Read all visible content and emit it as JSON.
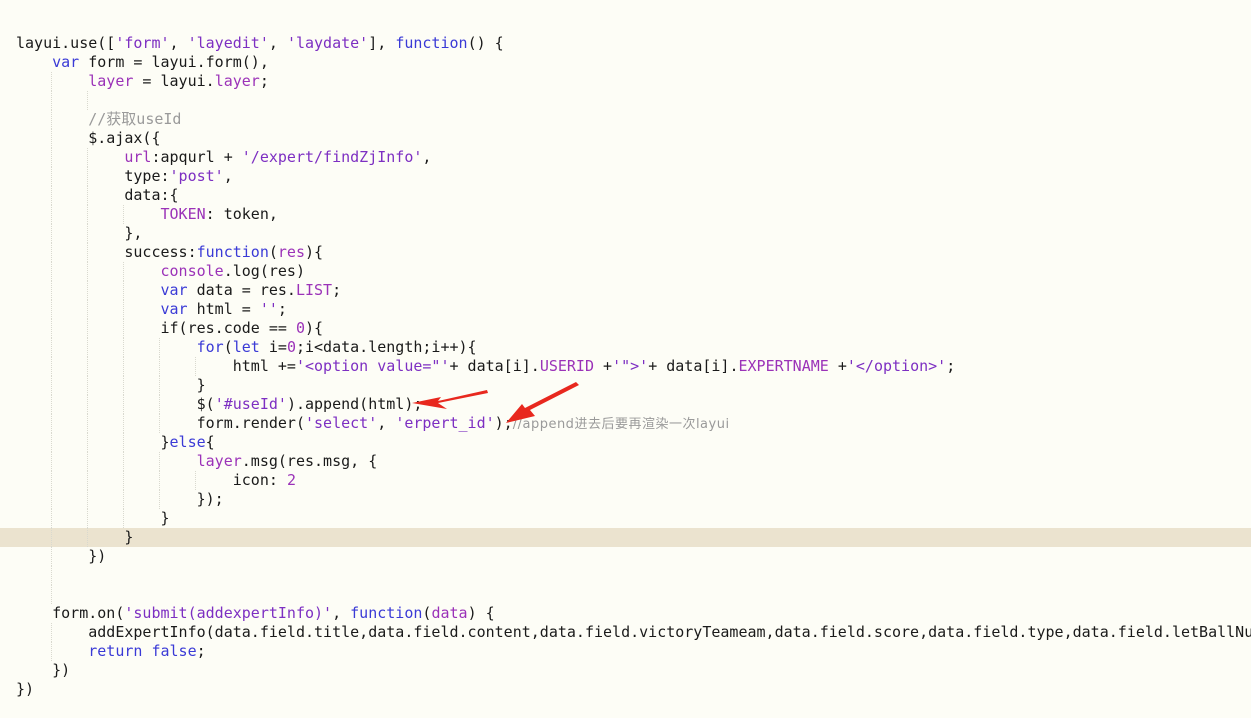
{
  "editor": {
    "lines": [
      {
        "indent": 0,
        "guides": [],
        "tokens": [
          {
            "t": "pl",
            "v": "layui.use(["
          },
          {
            "t": "str",
            "v": "'form'"
          },
          {
            "t": "pl",
            "v": ", "
          },
          {
            "t": "str",
            "v": "'layedit'"
          },
          {
            "t": "pl",
            "v": ", "
          },
          {
            "t": "str",
            "v": "'laydate'"
          },
          {
            "t": "pl",
            "v": "], "
          },
          {
            "t": "kw",
            "v": "function"
          },
          {
            "t": "pl",
            "v": "() {"
          }
        ]
      },
      {
        "indent": 1,
        "guides": [],
        "tokens": [
          {
            "t": "kw",
            "v": "var"
          },
          {
            "t": "pl",
            "v": " form = layui.form(),"
          }
        ]
      },
      {
        "indent": 2,
        "guides": [
          1
        ],
        "tokens": [
          {
            "t": "prop",
            "v": "layer"
          },
          {
            "t": "pl",
            "v": " = layui."
          },
          {
            "t": "prop",
            "v": "layer"
          },
          {
            "t": "pl",
            "v": ";"
          }
        ]
      },
      {
        "indent": 0,
        "guides": [
          1,
          2
        ],
        "tokens": []
      },
      {
        "indent": 2,
        "guides": [
          1
        ],
        "tokens": [
          {
            "t": "cmt",
            "v": "//获取useId"
          }
        ]
      },
      {
        "indent": 2,
        "guides": [
          1
        ],
        "tokens": [
          {
            "t": "pl",
            "v": "$.ajax({"
          }
        ]
      },
      {
        "indent": 3,
        "guides": [
          1,
          2
        ],
        "tokens": [
          {
            "t": "prop",
            "v": "url"
          },
          {
            "t": "pl",
            "v": ":apqurl + "
          },
          {
            "t": "str",
            "v": "'/expert/findZjInfo'"
          },
          {
            "t": "pl",
            "v": ","
          }
        ]
      },
      {
        "indent": 3,
        "guides": [
          1,
          2
        ],
        "tokens": [
          {
            "t": "pl",
            "v": "type:"
          },
          {
            "t": "str",
            "v": "'post'"
          },
          {
            "t": "pl",
            "v": ","
          }
        ]
      },
      {
        "indent": 3,
        "guides": [
          1,
          2
        ],
        "tokens": [
          {
            "t": "pl",
            "v": "data:{"
          }
        ]
      },
      {
        "indent": 4,
        "guides": [
          1,
          2,
          3
        ],
        "tokens": [
          {
            "t": "prop",
            "v": "TOKEN"
          },
          {
            "t": "pl",
            "v": ": token,"
          }
        ]
      },
      {
        "indent": 3,
        "guides": [
          1,
          2
        ],
        "tokens": [
          {
            "t": "pl",
            "v": "},"
          }
        ]
      },
      {
        "indent": 3,
        "guides": [
          1,
          2
        ],
        "tokens": [
          {
            "t": "pl",
            "v": "success:"
          },
          {
            "t": "kw",
            "v": "function"
          },
          {
            "t": "pl",
            "v": "("
          },
          {
            "t": "prop",
            "v": "res"
          },
          {
            "t": "pl",
            "v": "){"
          }
        ]
      },
      {
        "indent": 4,
        "guides": [
          1,
          2,
          3
        ],
        "tokens": [
          {
            "t": "prop",
            "v": "console"
          },
          {
            "t": "pl",
            "v": ".log(res)"
          }
        ]
      },
      {
        "indent": 4,
        "guides": [
          1,
          2,
          3
        ],
        "tokens": [
          {
            "t": "kw",
            "v": "var"
          },
          {
            "t": "pl",
            "v": " data = res."
          },
          {
            "t": "prop",
            "v": "LIST"
          },
          {
            "t": "pl",
            "v": ";"
          }
        ]
      },
      {
        "indent": 4,
        "guides": [
          1,
          2,
          3
        ],
        "tokens": [
          {
            "t": "kw",
            "v": "var"
          },
          {
            "t": "pl",
            "v": " html = "
          },
          {
            "t": "str",
            "v": "''"
          },
          {
            "t": "pl",
            "v": ";"
          }
        ]
      },
      {
        "indent": 4,
        "guides": [
          1,
          2,
          3
        ],
        "tokens": [
          {
            "t": "pl",
            "v": "if(res.code == "
          },
          {
            "t": "num",
            "v": "0"
          },
          {
            "t": "pl",
            "v": "){"
          }
        ]
      },
      {
        "indent": 5,
        "guides": [
          1,
          2,
          3,
          4
        ],
        "tokens": [
          {
            "t": "kw",
            "v": "for"
          },
          {
            "t": "pl",
            "v": "("
          },
          {
            "t": "kw",
            "v": "let"
          },
          {
            "t": "pl",
            "v": " i="
          },
          {
            "t": "num",
            "v": "0"
          },
          {
            "t": "pl",
            "v": ";i<data.length;i++){"
          }
        ]
      },
      {
        "indent": 6,
        "guides": [
          1,
          2,
          3,
          4,
          5
        ],
        "tokens": [
          {
            "t": "pl",
            "v": "html +="
          },
          {
            "t": "str",
            "v": "'<option value=\"'"
          },
          {
            "t": "pl",
            "v": "+ data[i]."
          },
          {
            "t": "prop",
            "v": "USERID"
          },
          {
            "t": "pl",
            "v": " +"
          },
          {
            "t": "str",
            "v": "'\">'"
          },
          {
            "t": "pl",
            "v": "+ data[i]."
          },
          {
            "t": "prop",
            "v": "EXPERTNAME"
          },
          {
            "t": "pl",
            "v": " +"
          },
          {
            "t": "str",
            "v": "'</option>'"
          },
          {
            "t": "pl",
            "v": ";"
          }
        ]
      },
      {
        "indent": 5,
        "guides": [
          1,
          2,
          3,
          4
        ],
        "tokens": [
          {
            "t": "pl",
            "v": "}"
          }
        ]
      },
      {
        "indent": 5,
        "guides": [
          1,
          2,
          3,
          4
        ],
        "tokens": [
          {
            "t": "pl",
            "v": "$("
          },
          {
            "t": "str",
            "v": "'#useId'"
          },
          {
            "t": "pl",
            "v": ").append(html);"
          }
        ]
      },
      {
        "indent": 5,
        "guides": [
          1,
          2,
          3,
          4
        ],
        "tokens": [
          {
            "t": "pl",
            "v": "form.render("
          },
          {
            "t": "str",
            "v": "'select'"
          },
          {
            "t": "pl",
            "v": ", "
          },
          {
            "t": "str",
            "v": "'erpert_id'"
          },
          {
            "t": "pl",
            "v": ");"
          },
          {
            "t": "cmt",
            "v": "//append进去后要再渲染一次layui",
            "cjk": true
          }
        ]
      },
      {
        "indent": 4,
        "guides": [
          1,
          2,
          3
        ],
        "tokens": [
          {
            "t": "pl",
            "v": "}"
          },
          {
            "t": "kw",
            "v": "else"
          },
          {
            "t": "pl",
            "v": "{"
          }
        ]
      },
      {
        "indent": 5,
        "guides": [
          1,
          2,
          3,
          4
        ],
        "tokens": [
          {
            "t": "prop",
            "v": "layer"
          },
          {
            "t": "pl",
            "v": ".msg(res.msg, {"
          }
        ]
      },
      {
        "indent": 6,
        "guides": [
          1,
          2,
          3,
          4,
          5
        ],
        "tokens": [
          {
            "t": "pl",
            "v": "icon: "
          },
          {
            "t": "num",
            "v": "2"
          }
        ]
      },
      {
        "indent": 5,
        "guides": [
          1,
          2,
          3,
          4
        ],
        "tokens": [
          {
            "t": "pl",
            "v": "});"
          }
        ]
      },
      {
        "indent": 4,
        "guides": [
          1,
          2,
          3
        ],
        "tokens": [
          {
            "t": "pl",
            "v": "}"
          }
        ]
      },
      {
        "indent": 3,
        "guides": [
          1,
          2
        ],
        "highlight": true,
        "tokens": [
          {
            "t": "pl",
            "v": "}"
          }
        ]
      },
      {
        "indent": 2,
        "guides": [
          1
        ],
        "tokens": [
          {
            "t": "pl",
            "v": "})"
          }
        ]
      },
      {
        "indent": 0,
        "guides": [
          1
        ],
        "tokens": []
      },
      {
        "indent": 0,
        "guides": [
          1
        ],
        "tokens": []
      },
      {
        "indent": 1,
        "guides": [],
        "tokens": [
          {
            "t": "pl",
            "v": "form.on("
          },
          {
            "t": "str",
            "v": "'submit(addexpertInfo)'"
          },
          {
            "t": "pl",
            "v": ", "
          },
          {
            "t": "kw",
            "v": "function"
          },
          {
            "t": "pl",
            "v": "("
          },
          {
            "t": "prop",
            "v": "data"
          },
          {
            "t": "pl",
            "v": ") {"
          }
        ]
      },
      {
        "indent": 2,
        "guides": [
          1
        ],
        "tokens": [
          {
            "t": "pl",
            "v": "addExpertInfo(data.field.title,data.field.content,data.field.victoryTeameam,data.field.score,data.field.type,data.field.letBallNum"
          }
        ]
      },
      {
        "indent": 2,
        "guides": [
          1
        ],
        "tokens": [
          {
            "t": "kw",
            "v": "return"
          },
          {
            "t": "pl",
            "v": " "
          },
          {
            "t": "kw",
            "v": "false"
          },
          {
            "t": "pl",
            "v": ";"
          }
        ]
      },
      {
        "indent": 1,
        "guides": [],
        "tokens": [
          {
            "t": "pl",
            "v": "})"
          }
        ]
      },
      {
        "indent": 0,
        "guides": [],
        "tokens": [
          {
            "t": "pl",
            "v": "})"
          }
        ]
      }
    ],
    "colors": {
      "background": "#fdfdf6",
      "highlight_line": "#ebe3cf",
      "keyword": "#3a3ad6",
      "string": "#7d2fc2",
      "property": "#9b32b8",
      "comment": "#9a9a9a",
      "annotation_arrow": "#e8281e"
    },
    "annotations": [
      {
        "name": "red-arrow-append",
        "points_to_line": 19
      },
      {
        "name": "red-arrow-render",
        "points_to_line": 20
      }
    ]
  }
}
